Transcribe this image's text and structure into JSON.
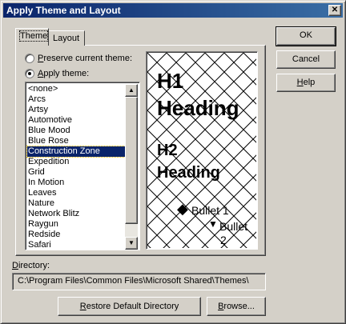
{
  "window": {
    "title": "Apply Theme and Layout",
    "close_glyph": "✕"
  },
  "tabs": [
    {
      "label": "Theme",
      "active": true
    },
    {
      "label": "Layout",
      "active": false
    }
  ],
  "radios": {
    "preserve": {
      "label_key": "P",
      "label_rest": "reserve current theme:",
      "checked": false
    },
    "apply": {
      "label_key": "A",
      "label_rest": "pply theme:",
      "checked": true
    }
  },
  "theme_list": {
    "items": [
      "<none>",
      "Arcs",
      "Artsy",
      "Automotive",
      "Blue Mood",
      "Blue Rose",
      "Construction Zone",
      "Expedition",
      "Grid",
      "In Motion",
      "Leaves",
      "Nature",
      "Network Blitz",
      "Raygun",
      "Redside",
      "Safari"
    ],
    "selected": "Construction Zone",
    "scroll_up_glyph": "▲",
    "scroll_down_glyph": "▼"
  },
  "preview": {
    "h1_line1": "H1",
    "h1_line2": "Heading",
    "h2_line1": "H2",
    "h2_line2": "Heading",
    "bullet1": "Bullet 1",
    "bullet2_line1": "Bullet",
    "bullet2_line2": "2",
    "bullet1_glyph": "◆",
    "bullet2_glyph": "▼"
  },
  "directory": {
    "label_key": "D",
    "label_rest": "irectory:",
    "value": "C:\\Program Files\\Common Files\\Microsoft Shared\\Themes\\"
  },
  "buttons": {
    "ok": "OK",
    "cancel": "Cancel",
    "help_key": "H",
    "help_rest": "elp",
    "restore_key": "R",
    "restore_rest": "estore Default Directory",
    "browse_key": "B",
    "browse_rest": "rowse..."
  },
  "colors": {
    "face": "#d4d0c8",
    "title_start": "#0a246a",
    "title_end": "#3a6ea5",
    "selection": "#0a246a"
  }
}
